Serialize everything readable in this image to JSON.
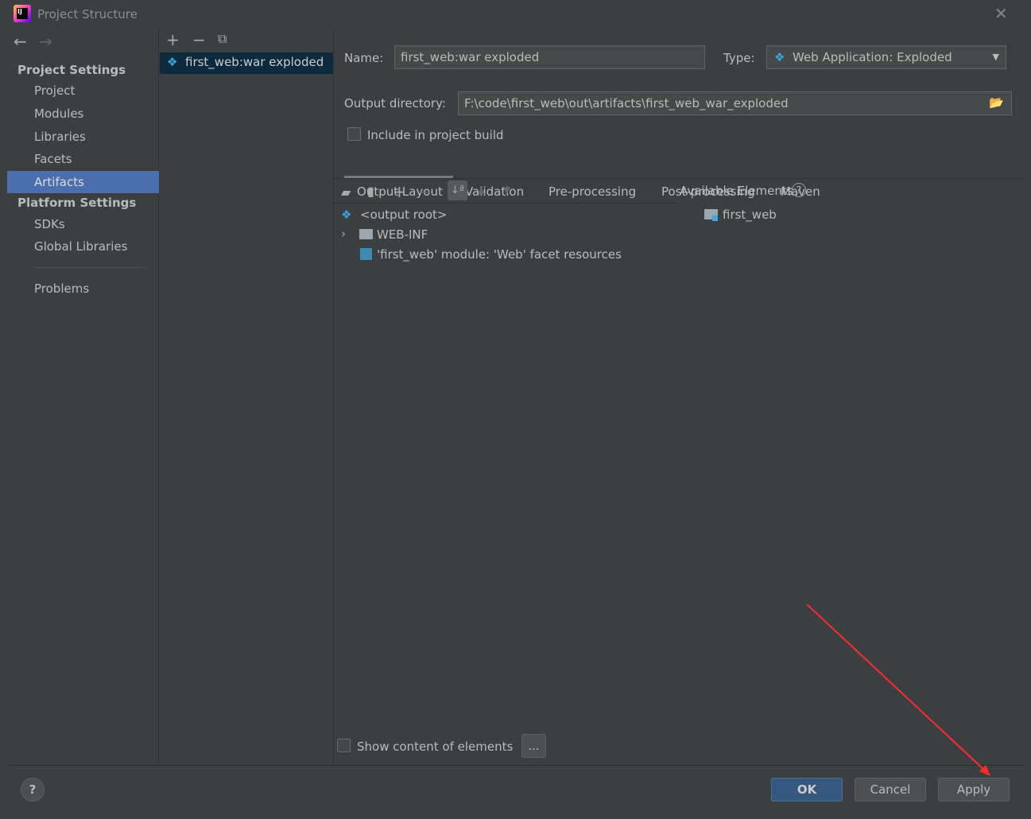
{
  "window": {
    "title": "Project Structure"
  },
  "nav": {
    "back": "←",
    "forward": "→"
  },
  "sidebar": {
    "project_settings": "Project Settings",
    "items": [
      {
        "label": "Project"
      },
      {
        "label": "Modules"
      },
      {
        "label": "Libraries"
      },
      {
        "label": "Facets"
      },
      {
        "label": "Artifacts",
        "selected": true
      }
    ],
    "platform_settings": "Platform Settings",
    "platform_items": [
      {
        "label": "SDKs"
      },
      {
        "label": "Global Libraries"
      }
    ],
    "problems": "Problems"
  },
  "artifacts": {
    "items": [
      {
        "label": "first_web:war exploded"
      }
    ]
  },
  "form": {
    "name_label": "Name:",
    "name_value": "first_web:war exploded",
    "type_label": "Type:",
    "type_value": "Web Application: Exploded",
    "output_label": "Output directory:",
    "output_value": "F:\\code\\first_web\\out\\artifacts\\first_web_war_exploded",
    "include_label": "Include in project build",
    "include_checked": false
  },
  "tabs": [
    {
      "label": "Output Layout",
      "active": true
    },
    {
      "label": "Validation"
    },
    {
      "label": "Pre-processing"
    },
    {
      "label": "Post-processing"
    },
    {
      "label": "Maven"
    }
  ],
  "layout_tree": [
    {
      "label": "<output root>"
    },
    {
      "label": "WEB-INF"
    },
    {
      "label": "'first_web' module: 'Web' facet resources"
    }
  ],
  "available": {
    "title": "Available Elements",
    "items": [
      {
        "label": "first_web"
      }
    ]
  },
  "show_content": {
    "label": "Show content of elements",
    "checked": false,
    "more": "..."
  },
  "buttons": {
    "ok": "OK",
    "cancel": "Cancel",
    "apply": "Apply",
    "help": "?"
  },
  "colors": {
    "accent": "#4b6eaf",
    "selected_dark": "#0d293e",
    "ok": "#365880",
    "annotation_arrow": "#ff2a2a"
  }
}
